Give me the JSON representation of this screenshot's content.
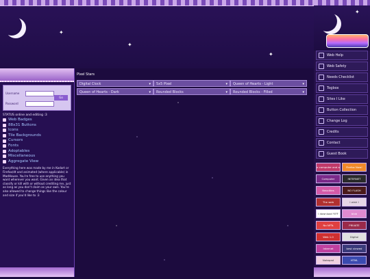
{
  "left": {
    "login": {
      "username_label": "Username",
      "password_label": "Password",
      "button": "Go"
    },
    "status": "STATUS online and editing :3",
    "nav": [
      "Web Badges",
      "88x31 Buttons",
      "Icons",
      "Tile Backgrounds",
      "Cursors",
      "Fonts",
      "Adoptables",
      "Miscellaneous",
      "Aggregate View"
    ],
    "note": "Everything here was made by me in Kodart or Firefox/dt and animated (where applicable) in MadHouse. You're free to use anything you want wherever you want. Given an idea that classify or kill with or without crediting me, just as long as you don't claim as your own. You're also allowed to change things like the colour and size if you'd like to :3"
  },
  "main": {
    "title": "Pixel Stars",
    "cells": [
      "Digital Clock",
      "5x5 Pixel",
      "Queen of Hearts - Light",
      "Queen of Hearts - Dark",
      "Rounded Blocks",
      "Rounded Blocks - Filled"
    ]
  },
  "right": {
    "nav": [
      "Web Help",
      "Web Safety",
      "Needs Checklist",
      "Togbox",
      "Sites I Like",
      "Button Collection",
      "Change Log",
      "Credits",
      "Contact",
      "Guest Book"
    ],
    "buttons": [
      "a computer and a mouse",
      "Firefox Now!",
      "Computer Accessible",
      "INTERNET ARCHIVE",
      "Neocities",
      "NO FLASH",
      "The web",
      "I wish I",
      "I download YIFF",
      "blob",
      "No NFTs",
      "PRIVATE",
      "Web 1.0",
      "Digital",
      "Internet",
      "best viewed",
      "Notepad",
      "HTML",
      "Learn HTML",
      "Neocities"
    ]
  }
}
